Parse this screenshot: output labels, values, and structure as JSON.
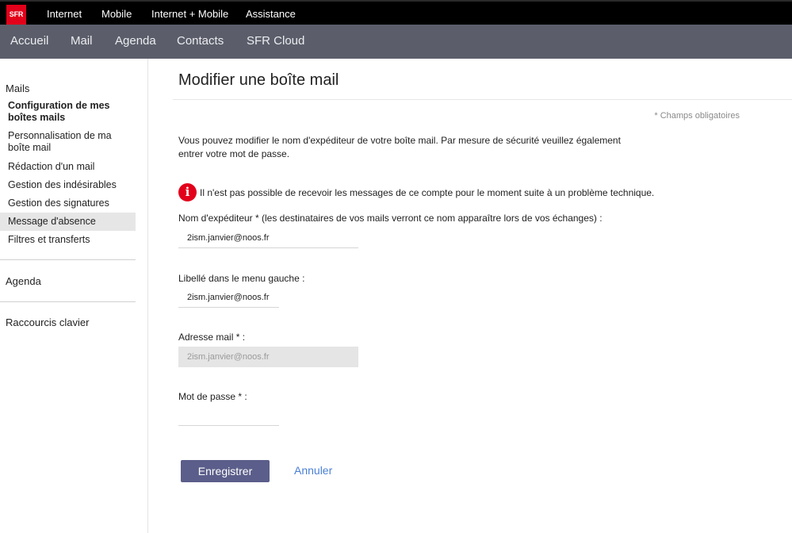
{
  "brand": {
    "logo_text": "SFR",
    "logo_color": "#e2001a"
  },
  "topnav": {
    "items": [
      {
        "label": "Internet"
      },
      {
        "label": "Mobile"
      },
      {
        "label": "Internet + Mobile"
      },
      {
        "label": "Assistance"
      }
    ]
  },
  "subnav": {
    "items": [
      {
        "label": "Accueil"
      },
      {
        "label": "Mail"
      },
      {
        "label": "Agenda"
      },
      {
        "label": "Contacts"
      },
      {
        "label": "SFR Cloud"
      }
    ]
  },
  "sidebar": {
    "mails_title": "Mails",
    "links": [
      {
        "label": "Configuration de mes boîtes mails",
        "state": "selected"
      },
      {
        "label": "Personnalisation de ma boîte mail"
      },
      {
        "label": "Rédaction d'un mail"
      },
      {
        "label": "Gestion des indésirables"
      },
      {
        "label": "Gestion des signatures"
      },
      {
        "label": "Message d'absence",
        "state": "highlighted"
      },
      {
        "label": "Filtres et transferts"
      }
    ],
    "agenda_title": "Agenda",
    "shortcuts_title": "Raccourcis clavier"
  },
  "main": {
    "title": "Modifier une boîte mail",
    "required_note": "* Champs obligatoires",
    "intro": "Vous pouvez modifier le nom d'expéditeur de votre boîte mail. Par mesure de sécurité veuillez également entrer votre mot de passe.",
    "alert": {
      "icon": "info-icon",
      "icon_glyph": "i",
      "text": "Il n'est pas possible de recevoir les messages de ce compte pour le moment suite à un problème technique."
    },
    "sender_name": {
      "label": "Nom d'expéditeur * (les destinataires de vos mails verront ce nom apparaître lors de vos échanges) :",
      "value": "2ism.janvier@noos.fr"
    },
    "menu_label": {
      "label": "Libellé dans le menu gauche :",
      "value": "2ism.janvier@noos.fr"
    },
    "email_address": {
      "label": "Adresse mail * :",
      "value": "2ism.janvier@noos.fr"
    },
    "password": {
      "label": "Mot de passe * :",
      "value": ""
    },
    "save_label": "Enregistrer",
    "cancel_label": "Annuler"
  },
  "colors": {
    "top_bar": "#000000",
    "sub_bar": "#5b5e6a",
    "accent_red": "#e2001a",
    "button": "#5b5e8a",
    "link": "#4a7fd4"
  }
}
